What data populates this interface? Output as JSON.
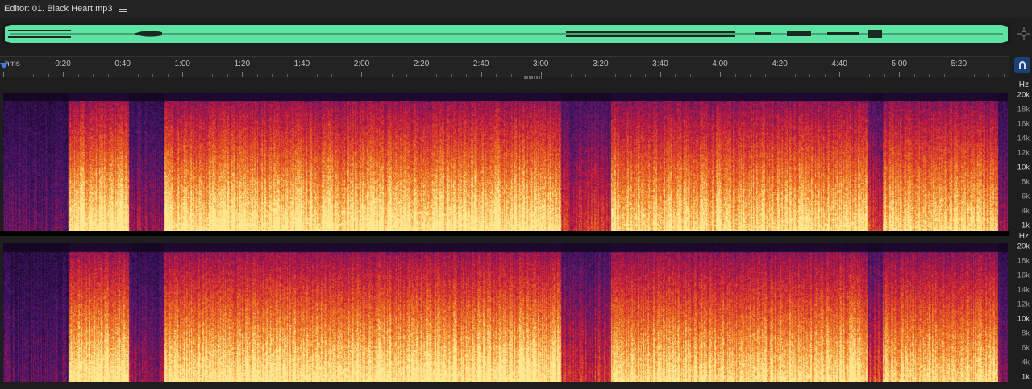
{
  "editor": {
    "title": "Editor: 01. Black Heart.mp3",
    "menu_icon": "hamburger-icon"
  },
  "overview": {
    "color": "#5fe3a4",
    "zoom_icon": "zoom-navigator-icon"
  },
  "ruler": {
    "unit": "hms",
    "ticks": [
      "0:20",
      "0:40",
      "1:00",
      "1:20",
      "1:40",
      "2:00",
      "2:20",
      "2:40",
      "3:00",
      "3:20",
      "3:40",
      "4:00",
      "4:20",
      "4:40",
      "5:00",
      "5:20"
    ],
    "duration_seconds": 338
  },
  "snap_button": {
    "icon": "magnet-icon",
    "color": "#1c3f78"
  },
  "channels": [
    {
      "hz_unit": "Hz",
      "hz_labels": [
        "20k",
        "18k",
        "16k",
        "14k",
        "12k",
        "10k",
        "8k",
        "6k",
        "4k",
        "1k"
      ]
    },
    {
      "hz_unit": "Hz",
      "hz_labels": [
        "20k",
        "18k",
        "16k",
        "14k",
        "12k",
        "10k",
        "8k",
        "6k",
        "4k",
        "1k"
      ]
    }
  ],
  "palette": {
    "quiet": "#12061e",
    "low": "#4a1770",
    "mid": "#c8173a",
    "high": "#f07a1a",
    "peak": "#ffe890"
  }
}
